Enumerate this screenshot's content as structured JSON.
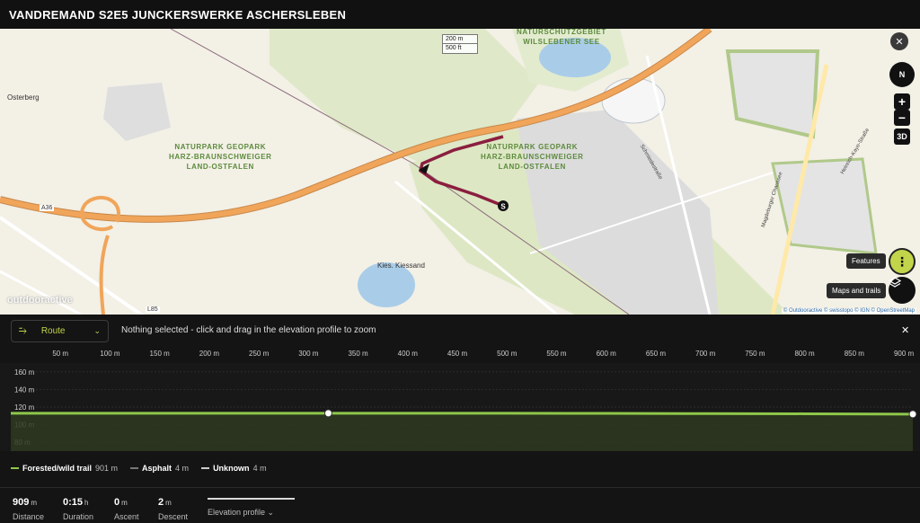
{
  "header": {
    "title": "VANDREMAND S2E5 JUNCKERSWERKE ASCHERSLEBEN"
  },
  "map": {
    "labels": {
      "osterberg": "Osterberg",
      "naturschutz_line1": "NATURSCHUTZGEBIET",
      "naturschutz_line2": "WILSLEBENER SEE",
      "park_line1": "NATURPARK GEOPARK",
      "park_line2": "HARZ-BRAUNSCHWEIGER",
      "park_line3": "LAND-OSTFALEN",
      "kies": "Kies. Kiessand",
      "a36": "A36",
      "l85": "L85",
      "road_magdeburger": "Magdeburger Chaussee",
      "road_schmiede": "Schmiedestraße",
      "road_heinrich": "Heinrich-Kaye-Straße"
    },
    "scale_metric": "200 m",
    "scale_imperial": "500 ft",
    "watermark": "outdooractive",
    "attribution": "© Outdooractive © swisstopo © IGN © OpenStreetMap",
    "start_marker": "S",
    "controls": {
      "close": "✕",
      "compass": "N",
      "zoom_in": "+",
      "zoom_out": "−",
      "three_d": "3D",
      "features_icon": "⋮",
      "features_tooltip": "Features",
      "maps_tooltip": "Maps and trails"
    }
  },
  "panel": {
    "route_icon": "⥲",
    "route_label": "Route",
    "route_chevron": "⌄",
    "hint": "Nothing selected - click and drag in the elevation profile to zoom",
    "close": "✕"
  },
  "chart_data": {
    "type": "area",
    "x_ticks": [
      "50 m",
      "100 m",
      "150 m",
      "200 m",
      "250 m",
      "300 m",
      "350 m",
      "400 m",
      "450 m",
      "500 m",
      "550 m",
      "600 m",
      "650 m",
      "700 m",
      "750 m",
      "800 m",
      "850 m",
      "900 m"
    ],
    "y_ticks": [
      "160 m",
      "140 m",
      "120 m",
      "100 m",
      "80 m"
    ],
    "x_range": [
      0,
      909
    ],
    "y_range": [
      70,
      170
    ],
    "grid": true,
    "series": [
      {
        "x": [
          0,
          100,
          200,
          320,
          400,
          500,
          600,
          700,
          800,
          909
        ],
        "y": [
          113,
          113,
          113,
          113,
          113,
          113,
          112.8,
          112.6,
          112.4,
          112
        ]
      }
    ],
    "markers": [
      {
        "x": 320,
        "y": 113
      },
      {
        "x": 909,
        "y": 112
      }
    ],
    "colors": {
      "line": "#8fc74a",
      "fill": "#2e3a20"
    }
  },
  "legend": [
    {
      "name": "Forested/wild trail",
      "value": "901 m",
      "color": "#8fc74a"
    },
    {
      "name": "Asphalt",
      "value": "4 m",
      "color": "#777777"
    },
    {
      "name": "Unknown",
      "value": "4 m",
      "color": "#cccccc"
    }
  ],
  "stats": {
    "distance": {
      "value": "909",
      "unit": "m",
      "label": "Distance"
    },
    "duration": {
      "value": "0:15",
      "unit": "h",
      "label": "Duration"
    },
    "ascent": {
      "value": "0",
      "unit": "m",
      "label": "Ascent"
    },
    "descent": {
      "value": "2",
      "unit": "m",
      "label": "Descent"
    },
    "elevation_tab": "Elevation profile ⌄"
  },
  "colors": {
    "accent": "#c2d54a",
    "route": "#8b1e3f",
    "motorway": "#f0a55a"
  }
}
